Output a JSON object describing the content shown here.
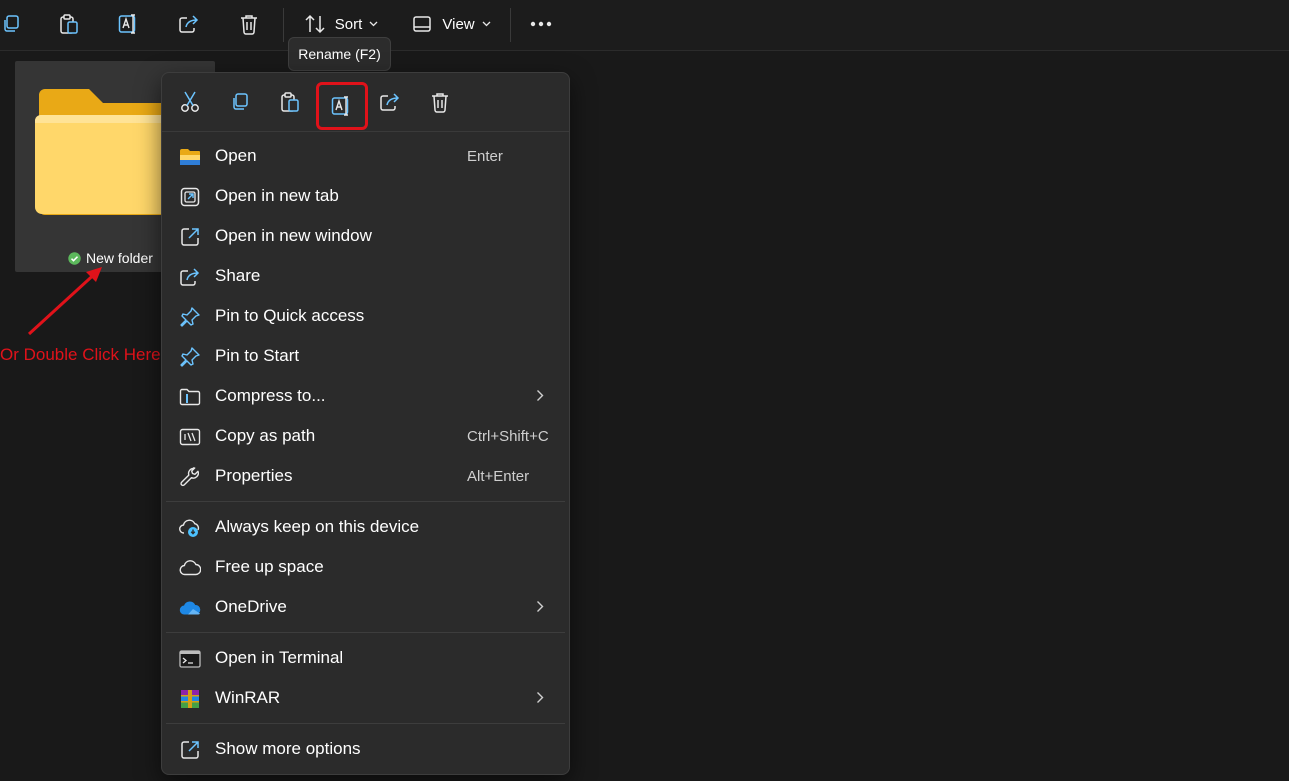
{
  "toolbar": {
    "sort_label": "Sort",
    "view_label": "View",
    "icons": [
      "copy-icon",
      "paste-icon",
      "rename-icon",
      "share-icon",
      "delete-icon",
      "sort-icon",
      "view-icon",
      "more-icon"
    ]
  },
  "tooltip": {
    "text": "Rename (F2)"
  },
  "folder": {
    "name": "New folder",
    "status_icon": "sync-ok-icon",
    "folder_color": "#f8c63a"
  },
  "annotation": {
    "text": "Or Double Click Here",
    "color": "#e0121a"
  },
  "context_menu": {
    "quick_actions": [
      "cut-icon",
      "copy-icon",
      "paste-icon",
      "rename-icon",
      "share-icon",
      "delete-icon"
    ],
    "highlighted_action": "rename-icon",
    "items": [
      {
        "label": "Open",
        "shortcut": "Enter",
        "icon": "folder-icon"
      },
      {
        "label": "Open in new tab",
        "shortcut": "",
        "icon": "new-tab-icon"
      },
      {
        "label": "Open in new window",
        "shortcut": "",
        "icon": "new-window-icon"
      },
      {
        "label": "Share",
        "shortcut": "",
        "icon": "share-icon"
      },
      {
        "label": "Pin to Quick access",
        "shortcut": "",
        "icon": "pin-icon"
      },
      {
        "label": "Pin to Start",
        "shortcut": "",
        "icon": "pin-icon"
      },
      {
        "label": "Compress to...",
        "shortcut": "",
        "icon": "zip-icon",
        "submenu": true
      },
      {
        "label": "Copy as path",
        "shortcut": "Ctrl+Shift+C",
        "icon": "copy-path-icon"
      },
      {
        "label": "Properties",
        "shortcut": "Alt+Enter",
        "icon": "wrench-icon"
      },
      {
        "label": "Always keep on this device",
        "shortcut": "",
        "icon": "cloud-keep-icon"
      },
      {
        "label": "Free up space",
        "shortcut": "",
        "icon": "cloud-outline-icon"
      },
      {
        "label": "OneDrive",
        "shortcut": "",
        "icon": "onedrive-icon",
        "submenu": true
      },
      {
        "label": "Open in Terminal",
        "shortcut": "",
        "icon": "terminal-icon"
      },
      {
        "label": "WinRAR",
        "shortcut": "",
        "icon": "winrar-icon",
        "submenu": true
      },
      {
        "label": "Show more options",
        "shortcut": "",
        "icon": "more-options-icon"
      }
    ]
  },
  "colors": {
    "accent": "#4cc2ff",
    "highlight": "#e0121a",
    "menu_bg": "#2b2b2b",
    "window_bg": "#191919"
  }
}
